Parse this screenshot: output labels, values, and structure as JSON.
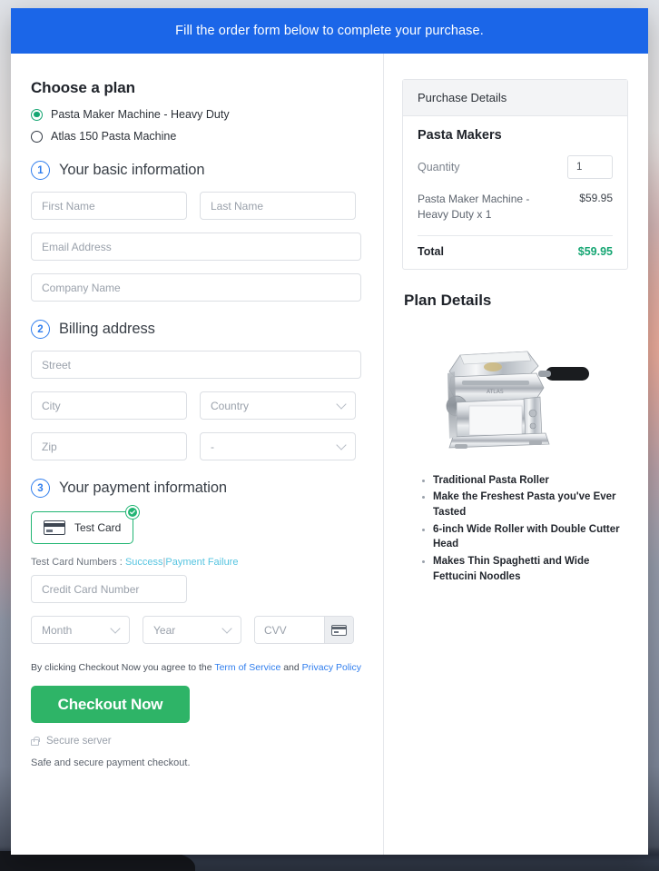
{
  "banner": {
    "text": "Fill the order form below to complete your purchase."
  },
  "plan": {
    "heading": "Choose a plan",
    "options": [
      {
        "label": "Pasta Maker Machine - Heavy Duty",
        "selected": true
      },
      {
        "label": "Atlas 150 Pasta Machine",
        "selected": false
      }
    ]
  },
  "steps": {
    "basic": {
      "num": "1",
      "title": "Your basic information"
    },
    "billing": {
      "num": "2",
      "title": "Billing address"
    },
    "payment": {
      "num": "3",
      "title": "Your payment information"
    }
  },
  "fields": {
    "first_name": {
      "placeholder": "First Name",
      "value": ""
    },
    "last_name": {
      "placeholder": "Last Name",
      "value": ""
    },
    "email": {
      "placeholder": "Email Address",
      "value": ""
    },
    "company": {
      "placeholder": "Company Name",
      "value": ""
    },
    "street": {
      "placeholder": "Street",
      "value": ""
    },
    "city": {
      "placeholder": "City",
      "value": ""
    },
    "country": {
      "value": "Country"
    },
    "zip": {
      "placeholder": "Zip",
      "value": ""
    },
    "state": {
      "value": "-"
    },
    "card_number": {
      "placeholder": "Credit Card Number",
      "value": ""
    },
    "month": {
      "value": "Month"
    },
    "year": {
      "value": "Year"
    },
    "cvv": {
      "placeholder": "CVV",
      "value": ""
    }
  },
  "payment": {
    "method_label": "Test  Card",
    "method_selected": true,
    "test_prefix": "Test Card Numbers :",
    "test_success": "Success",
    "test_separator": "|",
    "test_failure": "Payment Failure"
  },
  "terms": {
    "before": "By clicking Checkout Now you agree to the",
    "tos": "Term of Service",
    "middle": "and",
    "privacy": "Privacy Policy"
  },
  "checkout": {
    "button_label": "Checkout Now",
    "secure_label": "Secure server",
    "safe_note": "Safe and secure payment checkout."
  },
  "purchase": {
    "header": "Purchase Details",
    "group_title": "Pasta Makers",
    "quantity_label": "Quantity",
    "quantity_value": "1",
    "line_items": [
      {
        "name": "Pasta Maker Machine - Heavy Duty x 1",
        "price": "$59.95"
      }
    ],
    "total_label": "Total",
    "total_value": "$59.95"
  },
  "plan_details": {
    "heading": "Plan Details",
    "product_image_alt": "chrome pasta maker machine with black handle",
    "features": [
      "Traditional Pasta Roller",
      "Make the Freshest Pasta you've Ever Tasted",
      "6-inch Wide Roller with Double Cutter Head",
      "Makes Thin Spaghetti and Wide Fettucini Noodles"
    ]
  },
  "colors": {
    "banner_blue": "#1b66e8",
    "accent_green": "#2eb467",
    "radio_green": "#16a673",
    "link_blue": "#2f7ded",
    "link_cyan": "#56c4e0",
    "step_blue": "#2f7ded"
  }
}
